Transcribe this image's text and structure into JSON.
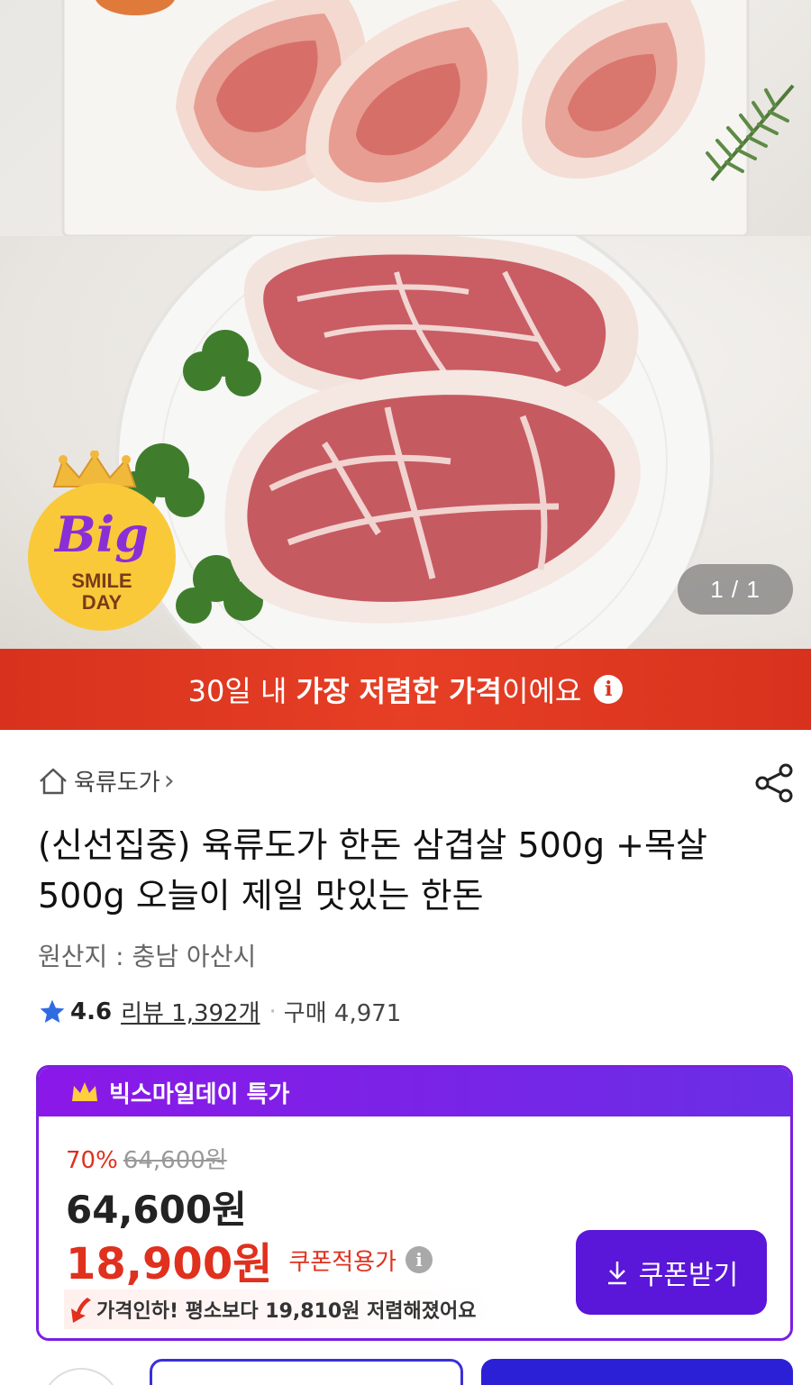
{
  "gallery": {
    "page_counter": "1 / 1",
    "badge": {
      "line1": "Big",
      "line2": "SMILE",
      "line3": "DAY"
    }
  },
  "promo_banner": {
    "prefix": "30일 내 ",
    "highlight": "가장 저렴한 가격",
    "suffix": "이에요",
    "info_glyph": "i"
  },
  "store": {
    "name": "육류도가",
    "chevron": "›"
  },
  "product": {
    "title": "(신선집중) 육류도가 한돈 삼겹살 500g +목살 500g 오늘이 제일 맛있는 한돈",
    "origin": "원산지 : 충남 아산시"
  },
  "rating": {
    "score": "4.6",
    "reviews": "리뷰 1,392개",
    "separator": "·",
    "purchases": "구매 4,971"
  },
  "deal": {
    "header": "빅스마일데이 특가",
    "discount_pct": "70%",
    "original_price": "64,600원",
    "sale_price": "64,600원",
    "coupon_price": "18,900원",
    "coupon_label": "쿠폰적용가",
    "info_glyph": "i",
    "price_drop": "가격인하! 평소보다 19,810원 저렴해졌어요",
    "coupon_button": "쿠폰받기"
  },
  "colors": {
    "banner_red": "#d8321e",
    "deal_purple": "#7a1fe0",
    "coupon_button": "#5a16d9",
    "price_red": "#e0301e",
    "cta_blue": "#2c20d6"
  }
}
